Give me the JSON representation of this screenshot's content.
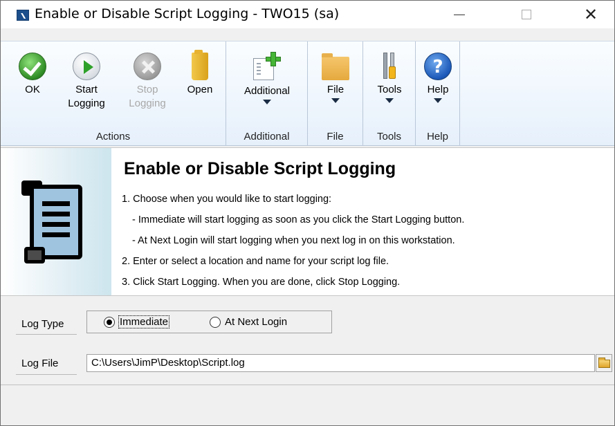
{
  "window": {
    "title": "Enable or Disable Script Logging  -  TWO15 (sa)",
    "controls": {
      "minimize": "minimize-icon",
      "maximize": "maximize-icon",
      "close": "close-icon"
    }
  },
  "ribbon": {
    "actions": {
      "group_label": "Actions",
      "ok": {
        "line1": "OK",
        "icon": "check-circle-icon"
      },
      "start": {
        "line1": "Start",
        "line2": "Logging",
        "icon": "play-circle-icon"
      },
      "stop": {
        "line1": "Stop",
        "line2": "Logging",
        "icon": "x-circle-icon",
        "disabled": true
      },
      "open": {
        "line1": "Open",
        "icon": "folder-icon"
      }
    },
    "additional": {
      "label": "Additional",
      "group_label": "Additional",
      "icon": "add-document-icon"
    },
    "file": {
      "label": "File",
      "group_label": "File",
      "icon": "file-folder-icon"
    },
    "tools": {
      "label": "Tools",
      "group_label": "Tools",
      "icon": "tools-icon"
    },
    "help": {
      "label": "Help",
      "group_label": "Help",
      "icon": "help-icon"
    }
  },
  "header": {
    "title": "Enable or Disable Script Logging",
    "instructions": [
      "1. Choose when you would like to start logging:",
      "- Immediate will start logging as soon as you click the Start Logging button.",
      "- At Next Login will start logging when you next log in on this workstation.",
      "2. Enter or select a location and name for your script log file.",
      "3. Click Start Logging.  When you are done, click Stop Logging."
    ],
    "icon": "scroll-icon"
  },
  "form": {
    "log_type": {
      "label": "Log Type",
      "options": [
        "Immediate",
        "At Next Login"
      ],
      "selected": "Immediate"
    },
    "log_file": {
      "label": "Log File",
      "value": "C:\\Users\\JimP\\Desktop\\Script.log"
    }
  }
}
